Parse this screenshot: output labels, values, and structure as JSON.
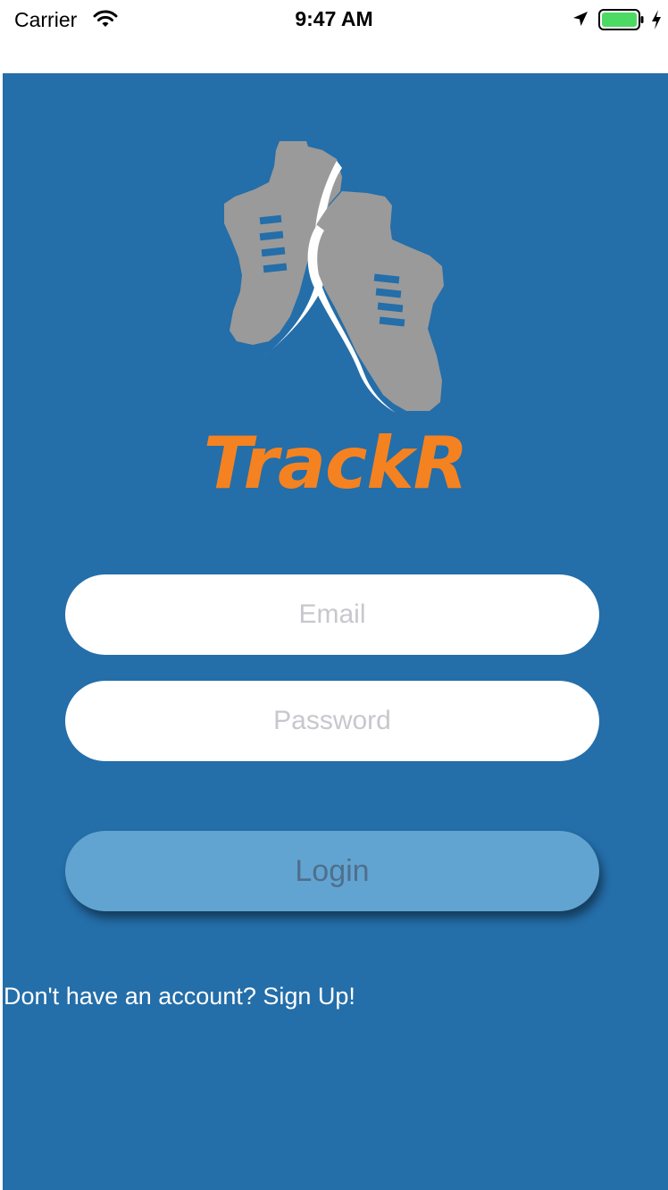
{
  "status_bar": {
    "carrier": "Carrier",
    "time": "9:47 AM",
    "icons": [
      "wifi-icon",
      "location-icon",
      "battery-icon",
      "charging-icon"
    ]
  },
  "logo": {
    "icon": "running-shoes-icon",
    "brand_name": "TrackR"
  },
  "login_form": {
    "email_placeholder": "Email",
    "email_value": "",
    "password_placeholder": "Password",
    "password_value": "",
    "login_label": "Login",
    "signup_text": "Don't have an account? Sign Up!"
  },
  "colors": {
    "background": "#246ea9",
    "brand": "#f58220",
    "button": "#62a4d1",
    "button_text": "#4e6f8c",
    "battery": "#4cd964"
  }
}
